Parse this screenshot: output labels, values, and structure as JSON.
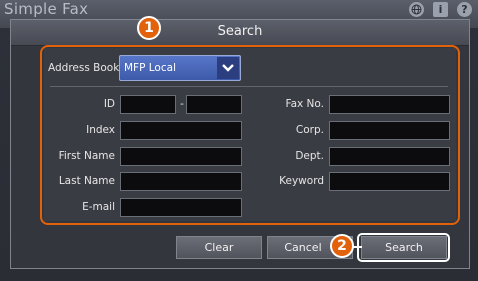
{
  "background": {
    "app_title": "Simple Fax",
    "icons": [
      "globe-icon",
      "info-icon",
      "help-icon"
    ]
  },
  "dialog": {
    "title": "Search"
  },
  "callouts": {
    "one": "1",
    "two": "2"
  },
  "address_book": {
    "label": "Address Book",
    "selected": "MFP Local"
  },
  "fields": {
    "id_label": "ID",
    "id_separator": "-",
    "index_label": "Index",
    "first_name_label": "First Name",
    "last_name_label": "Last Name",
    "email_label": "E-mail",
    "fax_label": "Fax No.",
    "corp_label": "Corp.",
    "dept_label": "Dept.",
    "keyword_label": "Keyword"
  },
  "buttons": {
    "clear": "Clear",
    "cancel": "Cancel",
    "search": "Search"
  },
  "colors": {
    "accent": "#e2620c",
    "select_bg": "#4a68b8",
    "field_bg": "#0c0c0f"
  }
}
